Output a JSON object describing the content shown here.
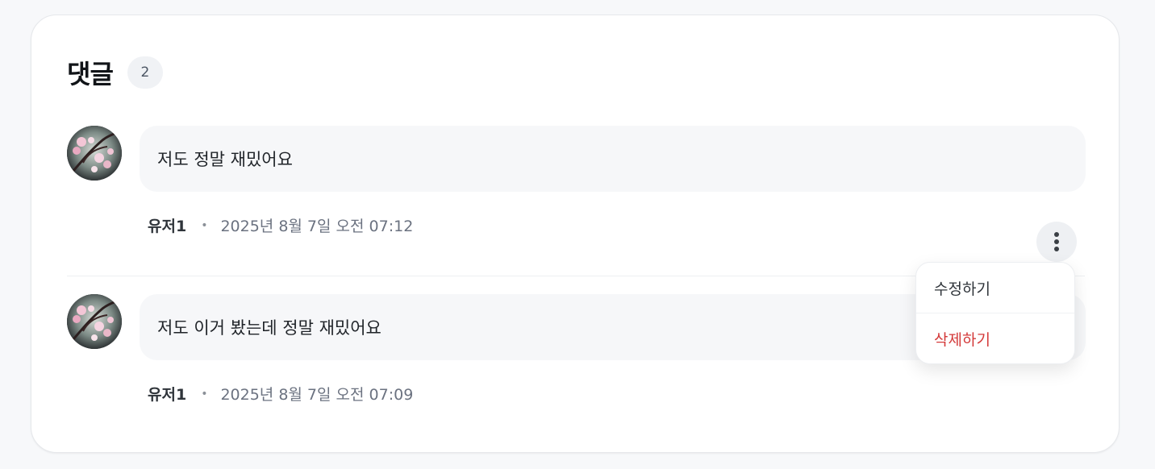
{
  "section": {
    "title": "댓글",
    "count": "2"
  },
  "comments": [
    {
      "text": "저도 정말 재밌어요",
      "author": "유저1",
      "separator": "•",
      "timestamp": "2025년 8월 7일 오전 07:12",
      "avatar_icon": "cherry-blossom-avatar"
    },
    {
      "text": "저도 이거 봤는데 정말 재밌어요",
      "author": "유저1",
      "separator": "•",
      "timestamp": "2025년 8월 7일 오전 07:09",
      "avatar_icon": "cherry-blossom-avatar"
    }
  ],
  "menu": {
    "trigger_icon": "more-vertical-icon",
    "items": [
      {
        "label": "수정하기",
        "color": "#2f343a"
      },
      {
        "label": "삭제하기",
        "color": "#d43a3a"
      }
    ]
  },
  "colors": {
    "background": "#f7f8fa",
    "card": "#ffffff",
    "bubble": "#f6f7f9",
    "danger": "#d43a3a",
    "muted": "#6b7280"
  }
}
